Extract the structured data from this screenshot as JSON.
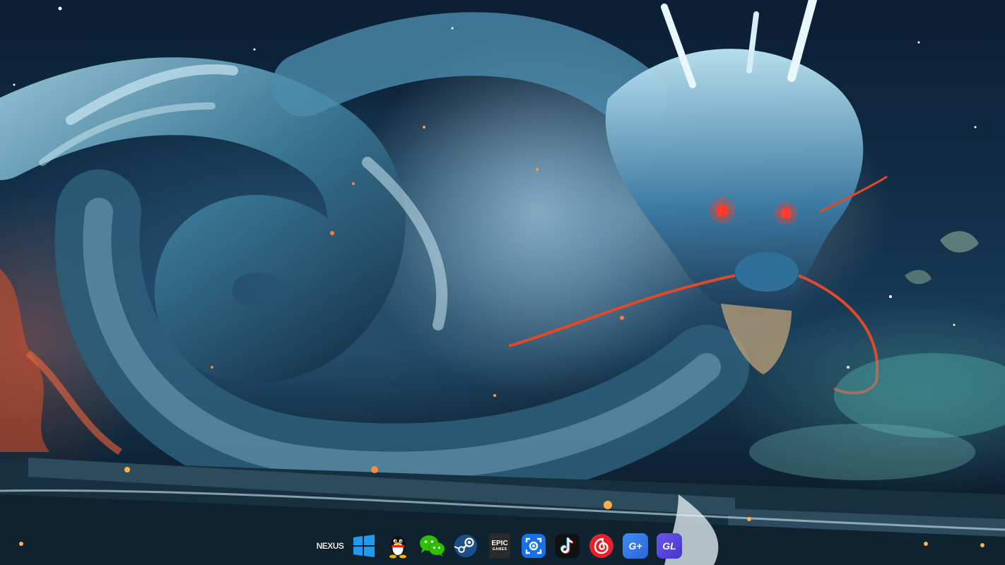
{
  "screen": {
    "type": "desktop",
    "wallpaper": "blue-dragon-night-wallpaper"
  },
  "dock": {
    "apps": [
      {
        "id": "nexus",
        "label": "NEXUS",
        "icon": "nexus-logo-icon"
      },
      {
        "id": "windows",
        "label": "",
        "icon": "windows-logo-icon",
        "color": "#1e9bf0"
      },
      {
        "id": "qq",
        "label": "",
        "icon": "qq-penguin-icon"
      },
      {
        "id": "wechat",
        "label": "",
        "icon": "wechat-bubble-icon",
        "color": "#2dc100"
      },
      {
        "id": "steam",
        "label": "",
        "icon": "steam-logo-icon",
        "color": "#1b4f8a"
      },
      {
        "id": "epic",
        "label": "EPIC",
        "sublabel": "GAMES",
        "icon": "epic-games-icon"
      },
      {
        "id": "screenshot",
        "label": "",
        "icon": "screenshot-tool-icon",
        "color": "#1670e8"
      },
      {
        "id": "tiktok",
        "label": "",
        "icon": "tiktok-icon"
      },
      {
        "id": "netease-music",
        "label": "",
        "icon": "netease-music-icon",
        "color": "#e5212a"
      },
      {
        "id": "g-plus",
        "label": "G+",
        "icon": "g-plus-app-icon"
      },
      {
        "id": "gl",
        "label": "GL",
        "icon": "gl-app-icon"
      }
    ]
  }
}
